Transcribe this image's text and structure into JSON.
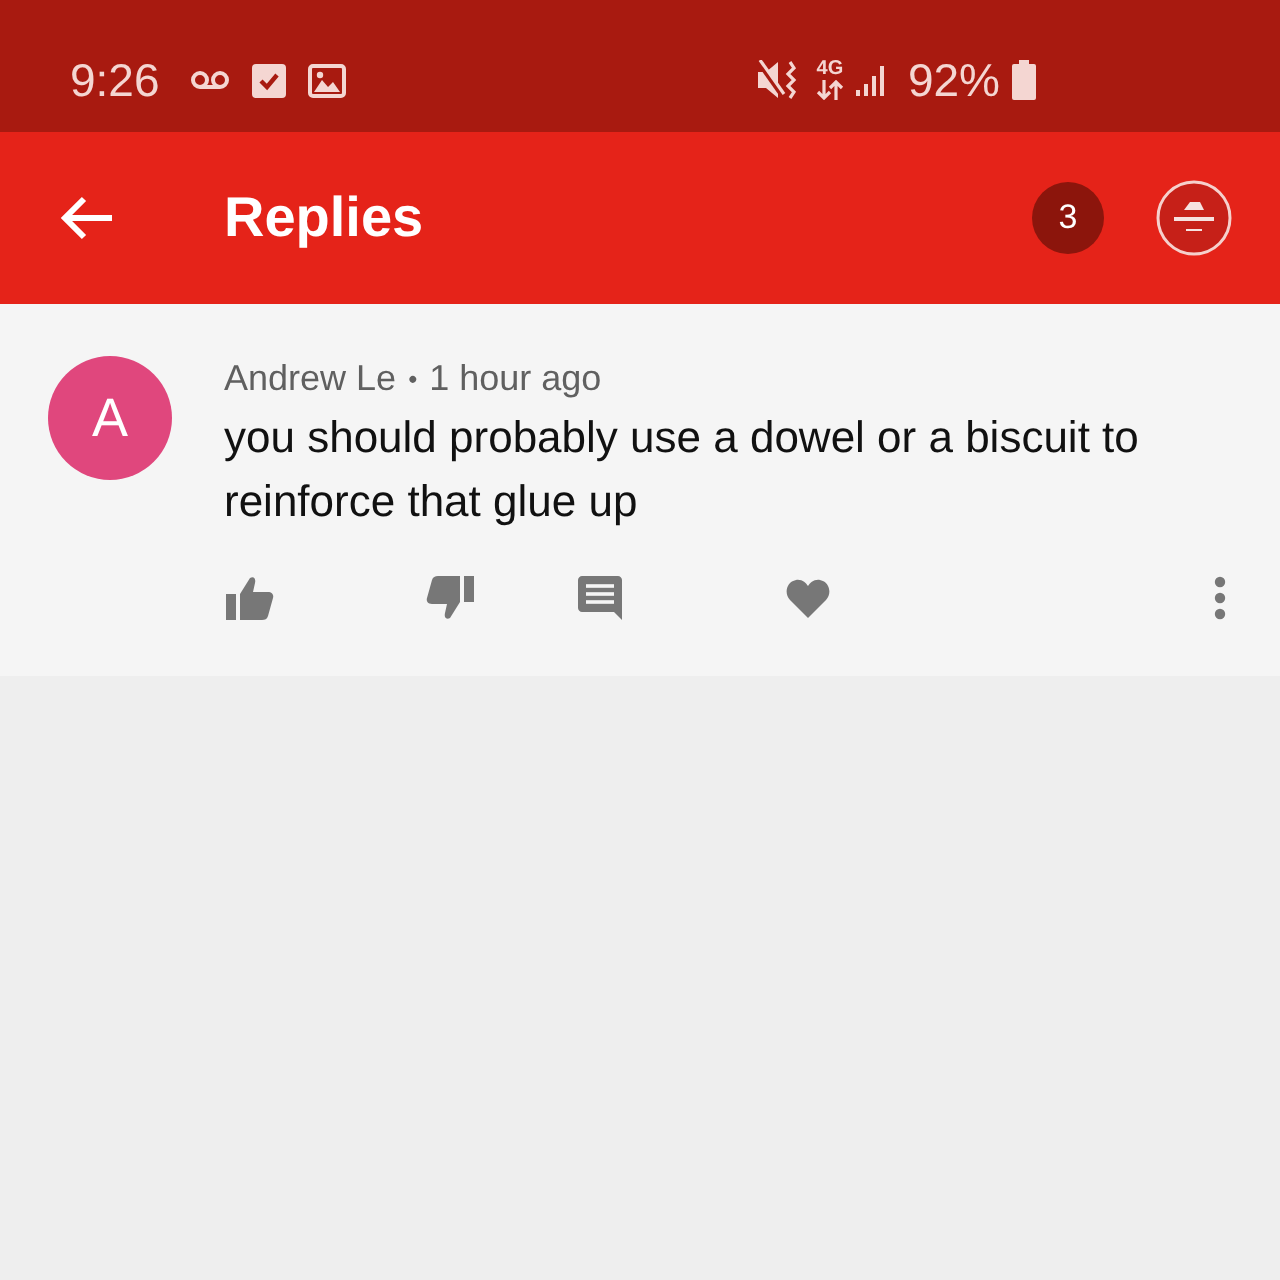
{
  "status_bar": {
    "time": "9:26",
    "network": "4G",
    "battery": "92%"
  },
  "app_bar": {
    "title": "Replies",
    "notification_count": "3"
  },
  "comment": {
    "avatar_letter": "A",
    "author": "Andrew Le",
    "separator": "•",
    "time": "1 hour ago",
    "text": "you should probably use a dowel or a biscuit to reinforce that glue up"
  }
}
